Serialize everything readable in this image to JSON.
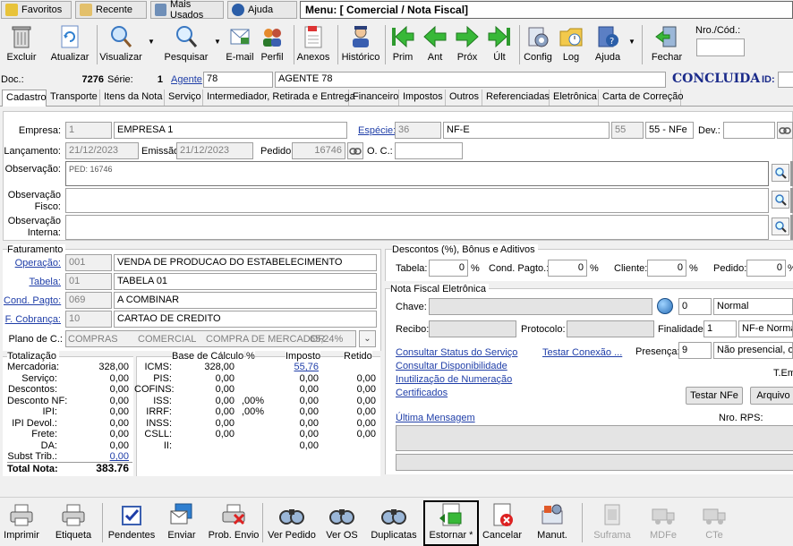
{
  "top_tabs": {
    "favoritos": "Favoritos",
    "recente": "Recente",
    "mais_usados": "Mais Usados",
    "ajuda": "Ajuda"
  },
  "menu_title": "Menu: [ Comercial / Nota Fiscal]",
  "toolbar": {
    "excluir": "Excluir",
    "atualizar": "Atualizar",
    "visualizar": "Visualizar",
    "pesquisar": "Pesquisar",
    "email": "E-mail",
    "perfil": "Perfil",
    "anexos": "Anexos",
    "historico": "Histórico",
    "prim": "Prim",
    "ant": "Ant",
    "prox": "Próx",
    "ult": "Últ",
    "config": "Config",
    "log": "Log",
    "ajuda": "Ajuda",
    "fechar": "Fechar",
    "nro_cod_label": "Nro./Cód.:",
    "nro_cod_value": ""
  },
  "doc_bar": {
    "doc_label": "Doc.:",
    "doc_value": "7276",
    "serie_label": "Série:",
    "serie_value": "1",
    "agente_label": "Agente",
    "agente_code": "78",
    "agente_name": "AGENTE 78",
    "status": "CONCLUIDA",
    "id_label": "ID:"
  },
  "tabs": [
    "Cadastro",
    "Transporte",
    "Itens da Nota",
    "Serviço",
    "Intermediador, Retirada e Entrega",
    "Financeiro",
    "Impostos",
    "Outros",
    "Referenciadas",
    "Eletrônica",
    "Carta de Correção"
  ],
  "header": {
    "empresa_label": "Empresa:",
    "empresa_code": "1",
    "empresa_name": "EMPRESA 1",
    "especie_label": "Espécie:",
    "especie_code": "36",
    "especie_name": "NF-E",
    "modelo_code": "55",
    "modelo_name": "55 - NFe",
    "dev_label": "Dev.:",
    "dev_value": "",
    "lancamento_label": "Lançamento:",
    "lancamento_value": "21/12/2023",
    "emissao_label": "Emissão",
    "emissao_value": "21/12/2023",
    "pedido_label": "Pedido:",
    "pedido_value": "16746",
    "oc_label": "O. C.:",
    "oc_value": "",
    "observacao_label": "Observação:",
    "observacao_value": "PED: 16746",
    "obs_fisco_label1": "Observação",
    "obs_fisco_label2": "Fisco:",
    "obs_fisco_value": "",
    "obs_interna_label1": "Observação",
    "obs_interna_label2": "Interna:",
    "obs_interna_value": ""
  },
  "faturamento": {
    "title": "Faturamento",
    "operacao_label": "Operação:",
    "operacao_code": "001",
    "operacao_name": "VENDA DE PRODUCAO DO ESTABELECIMENTO",
    "tabela_label": "Tabela:",
    "tabela_code": "01",
    "tabela_name": "TABELA 01",
    "cond_label": "Cond. Pagto:",
    "cond_code": "069",
    "cond_name": "A COMBINAR",
    "cobranca_label": "F. Cobrança:",
    "cobranca_code": "10",
    "cobranca_name": "CARTAO DE CREDITO",
    "plano_label": "Plano de C.:",
    "plano_a": "COMPRAS",
    "plano_b": "COMERCIAL",
    "plano_c": "COMPRA DE MERCADOR",
    "plano_pct": "65,24%"
  },
  "descontos": {
    "title": "Descontos (%), Bônus e Aditivos",
    "tabela_label": "Tabela:",
    "tabela_value": "0",
    "cond_label": "Cond. Pagto.:",
    "cond_value": "0",
    "cliente_label": "Cliente:",
    "cliente_value": "0",
    "pedido_label": "Pedido:",
    "pedido_value": "0",
    "pct": "%"
  },
  "nfe": {
    "title": "Nota Fiscal Eletrônica",
    "chave_label": "Chave:",
    "chave_value": "",
    "chave_num": "0",
    "chave_tipo": "Normal",
    "recibo_label": "Recibo:",
    "recibo_value": "",
    "protocolo_label": "Protocolo:",
    "protocolo_value": "",
    "finalidade_label": "Finalidade:",
    "finalidade_code": "1",
    "finalidade_name": "NF-e Normal",
    "link_status": "Consultar Status do Serviço",
    "link_testar": "Testar Conexão ...",
    "presenca_label": "Presença:",
    "presenca_code": "9",
    "presenca_name": "Não presencial, out",
    "link_disp": "Consultar Disponibilidade",
    "link_inut": "Inutilização de Numeração",
    "link_cert": "Certificados",
    "temi": "T.Em",
    "btn_testar": "Testar NFe",
    "btn_arquivo": "Arquivo",
    "link_ultima": "Última Mensagem",
    "rps_label": "Nro. RPS:"
  },
  "totalizacao": {
    "title": "Totalização",
    "rows": [
      {
        "label": "Mercadoria:",
        "value": "328,00"
      },
      {
        "label": "Serviço:",
        "value": "0,00"
      },
      {
        "label": "Descontos:",
        "value": "0,00"
      },
      {
        "label": "Desconto NF:",
        "value": "0,00"
      },
      {
        "label": "IPI:",
        "value": "0,00"
      },
      {
        "label": "IPI Devol.:",
        "value": "0,00"
      },
      {
        "label": "Frete:",
        "value": "0,00"
      },
      {
        "label": "DA:",
        "value": "0,00"
      },
      {
        "label": "Subst Trib.:",
        "value": "0,00"
      }
    ],
    "total_label": "Total Nota:",
    "total_value": "383.76"
  },
  "impostos": {
    "h_base": "Base de Cálculo",
    "h_pct": "%",
    "h_imposto": "Imposto",
    "h_retido": "Retido",
    "rows": [
      {
        "label": "ICMS:",
        "base": "328,00",
        "pct": "",
        "imposto": "55,76",
        "retido": ""
      },
      {
        "label": "PIS:",
        "base": "0,00",
        "pct": "",
        "imposto": "0,00",
        "retido": "0,00"
      },
      {
        "label": "COFINS:",
        "base": "0,00",
        "pct": "",
        "imposto": "0,00",
        "retido": "0,00"
      },
      {
        "label": "ISS:",
        "base": "0,00",
        "pct": ",00%",
        "imposto": "0,00",
        "retido": "0,00"
      },
      {
        "label": "IRRF:",
        "base": "0,00",
        "pct": ",00%",
        "imposto": "0,00",
        "retido": "0,00"
      },
      {
        "label": "INSS:",
        "base": "0,00",
        "pct": "",
        "imposto": "0,00",
        "retido": "0,00"
      },
      {
        "label": "CSLL:",
        "base": "0,00",
        "pct": "",
        "imposto": "0,00",
        "retido": "0,00"
      },
      {
        "label": "II:",
        "base": "",
        "pct": "",
        "imposto": "0,00",
        "retido": ""
      }
    ]
  },
  "bottom": {
    "imprimir": "Imprimir",
    "etiqueta": "Etiqueta",
    "pendentes": "Pendentes",
    "enviar": "Enviar",
    "prob_envio": "Prob. Envio",
    "ver_pedido": "Ver Pedido",
    "ver_os": "Ver OS",
    "duplicatas": "Duplicatas",
    "estornar": "Estornar *",
    "cancelar": "Cancelar",
    "manut": "Manut.",
    "suframa": "Suframa",
    "mdfe": "MDFe",
    "cte": "CTe"
  }
}
